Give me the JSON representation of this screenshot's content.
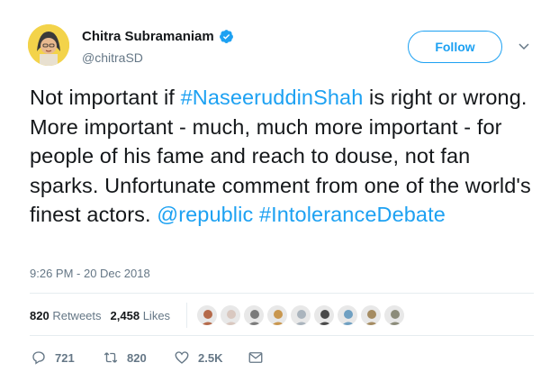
{
  "author": {
    "display_name": "Chitra Subramaniam",
    "handle": "@chitraSD",
    "verified": true
  },
  "follow_label": "Follow",
  "tweet": {
    "segments": [
      {
        "text": "Not important if ",
        "link": false
      },
      {
        "text": "#NaseeruddinShah",
        "link": true
      },
      {
        "text": " is right or wrong. More important - much, much more important - for people of his fame and reach to douse, not fan sparks. Unfortunate comment from one of the world's finest actors. ",
        "link": false
      },
      {
        "text": "@republic",
        "link": true
      },
      {
        "text": " ",
        "link": false
      },
      {
        "text": "#IntoleranceDebate",
        "link": true
      }
    ]
  },
  "timestamp": "9:26 PM - 20 Dec 2018",
  "stats": {
    "retweets_count": "820",
    "retweets_label": "Retweets",
    "likes_count": "2,458",
    "likes_label": "Likes"
  },
  "liker_avatars": [
    "#b56a4a",
    "#d9c8c0",
    "#7b7b7b",
    "#c9974f",
    "#aab4bd",
    "#4a4a4a",
    "#6fa0c2",
    "#a58c62",
    "#8c8c7a"
  ],
  "actions": {
    "reply_count": "721",
    "retweet_count": "820",
    "like_count": "2.5K"
  },
  "colors": {
    "accent": "#1da1f2",
    "secondary_text": "#657786"
  }
}
